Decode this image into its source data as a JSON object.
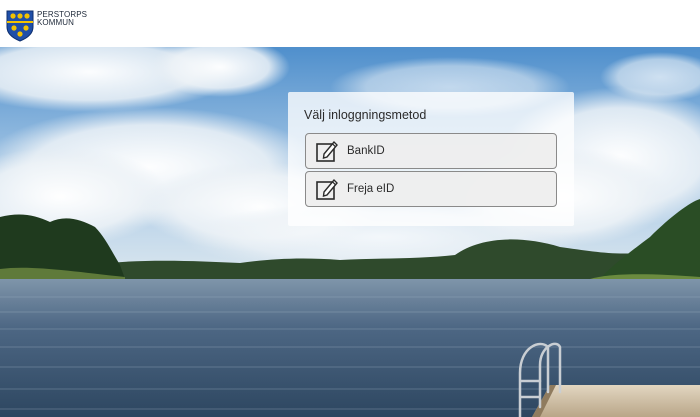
{
  "header": {
    "logo_line1": "PERSTORPS",
    "logo_line2": "KOMMUN"
  },
  "login": {
    "title": "Välj inloggningsmetod",
    "methods": [
      {
        "label": "BankID",
        "icon": "edit-document-icon"
      },
      {
        "label": "Freja eID",
        "icon": "edit-document-icon"
      }
    ]
  },
  "colors": {
    "shield_blue": "#1f4fa8",
    "shield_gold": "#f2c200",
    "panel_bg": "#ffffff",
    "button_border": "#8a8a8a"
  }
}
